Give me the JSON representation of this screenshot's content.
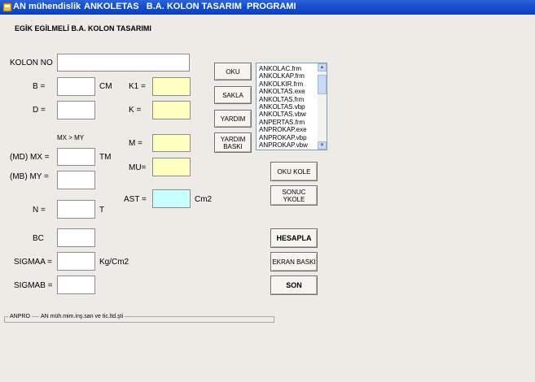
{
  "window": {
    "app_name": "AN mühendislik",
    "title": "ANKOLETAS   B.A. KOLON TASARIM  PROGRAMI"
  },
  "form": {
    "heading": "EGİK EGİLMELİ B.A. KOLON TASARIMI",
    "labels": {
      "kolon_no": "KOLON NO",
      "b": "B =",
      "d": "D =",
      "cm": "CM",
      "k1": "K1 =",
      "k": "K =",
      "mx_gt_my": "MX > MY",
      "md_mx": "(MD) MX =",
      "mb_my": "(MB) MY =",
      "tm": "TM",
      "m": "M =",
      "mu": "MU=",
      "n": "N =",
      "t": "T",
      "ast": "AST =",
      "cm2": "Cm2",
      "bc": "BC",
      "sigmaa": "SIGMAA =",
      "kg_cm2": "Kg/Cm2",
      "sigmab": "SIGMAB ="
    },
    "fields": {
      "kolon_no": "",
      "b": "",
      "d": "",
      "k1": "",
      "k": "",
      "mx": "",
      "my": "",
      "m": "",
      "mu": "",
      "n": "",
      "ast": "",
      "bc": "",
      "sigmaa": "",
      "sigmab": ""
    }
  },
  "buttons": {
    "oku": "OKU",
    "sakla": "SAKLA",
    "yardim": "YARDIM",
    "yardim_baski": "YARDIM\nBASKI",
    "oku_kole": "OKU KOLE",
    "sonuc_ykole": "SONUC\nYKOLE",
    "hesapla": "HESAPLA",
    "ekran_baski": "EKRAN BASKI",
    "son": "SON"
  },
  "file_list": {
    "items": [
      "ANKOLAC.frm",
      "ANKOLKAP.frm",
      "ANKOLKIR.frm",
      "ANKOLTAS.exe",
      "ANKOLTAS.frm",
      "ANKOLTAS.vbp",
      "ANKOLTAS.vbw",
      "ANPERTAS.frm",
      "ANPROKAP.exe",
      "ANPROKAP.vbp",
      "ANPROKAP.vbw"
    ]
  },
  "status": {
    "left": "ANPRO",
    "right": "AN müh.mim.inş.san ve tic.ltd.şti"
  },
  "colors": {
    "title_bar": "#1651D0",
    "yellow_field": "#FFFFC0",
    "cyan_field": "#C8FFFF"
  },
  "icons": {
    "window_icon": "app-icon",
    "scroll_up": "arrow-up-icon",
    "scroll_down": "arrow-down-icon"
  }
}
